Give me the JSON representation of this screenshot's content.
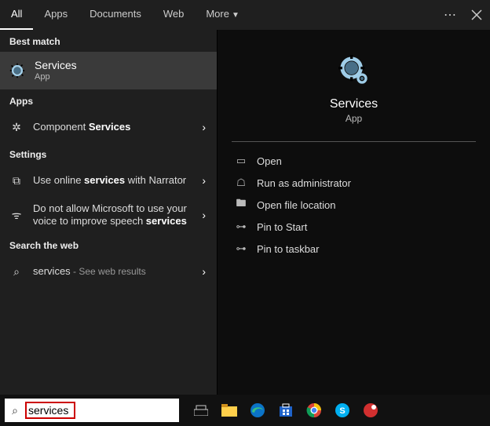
{
  "tabs": {
    "all": "All",
    "apps": "Apps",
    "documents": "Documents",
    "web": "Web",
    "more": "More"
  },
  "sections": {
    "best": "Best match",
    "apps": "Apps",
    "settings": "Settings",
    "web": "Search the web"
  },
  "best": {
    "title": "Services",
    "subtitle": "App"
  },
  "appsList": {
    "component_a": "Component ",
    "component_b": "Services"
  },
  "settingsList": {
    "narrator_a": "Use online ",
    "narrator_b": "services",
    "narrator_c": " with Narrator",
    "speech_a": "Do not allow Microsoft to use your voice to improve speech ",
    "speech_b": "services"
  },
  "webList": {
    "query": "services",
    "hint": " - See web results"
  },
  "detail": {
    "title": "Services",
    "subtitle": "App"
  },
  "actions": {
    "open": "Open",
    "admin": "Run as administrator",
    "loc": "Open file location",
    "pinStart": "Pin to Start",
    "pinTask": "Pin to taskbar"
  },
  "search": {
    "value": "services"
  }
}
